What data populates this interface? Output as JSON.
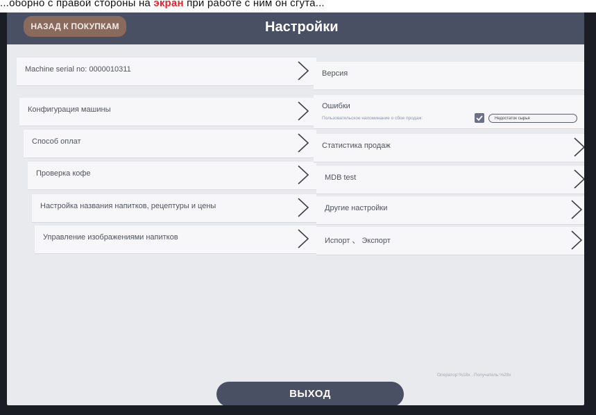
{
  "caption": {
    "prefix": "...оборно с правой стороны на ",
    "highlight": "экран",
    "suffix": " при работе с ним он сгута..."
  },
  "header": {
    "back_label": "НАЗАД К ПОКУПКАМ",
    "title": "Настройки"
  },
  "left_menu": [
    {
      "label": "Machine serial no: 0000010311"
    },
    {
      "label": "Конфигурация машины"
    },
    {
      "label": "Способ оплат"
    },
    {
      "label": "Проверка кофе"
    },
    {
      "label": "Настройка названия напитков, рецептуры и цены"
    },
    {
      "label": "Управление изображениями напитков"
    }
  ],
  "right_menu": [
    {
      "label": "Версия"
    },
    {
      "label": "Ошибки",
      "reminder_text": "Пользовательское напоминание о сбое продаж:",
      "reminder_checked": true,
      "reminder_value": "Недостаток сырья"
    },
    {
      "label": "Статистика продаж"
    },
    {
      "label": "MDB test"
    },
    {
      "label": "Другие настройки"
    },
    {
      "label": "Испорт 、 Экспорт"
    }
  ],
  "footer": {
    "exit_label": "ВЫХОД",
    "operator_note": "Оператор:%18x , Получатель:%28x"
  }
}
